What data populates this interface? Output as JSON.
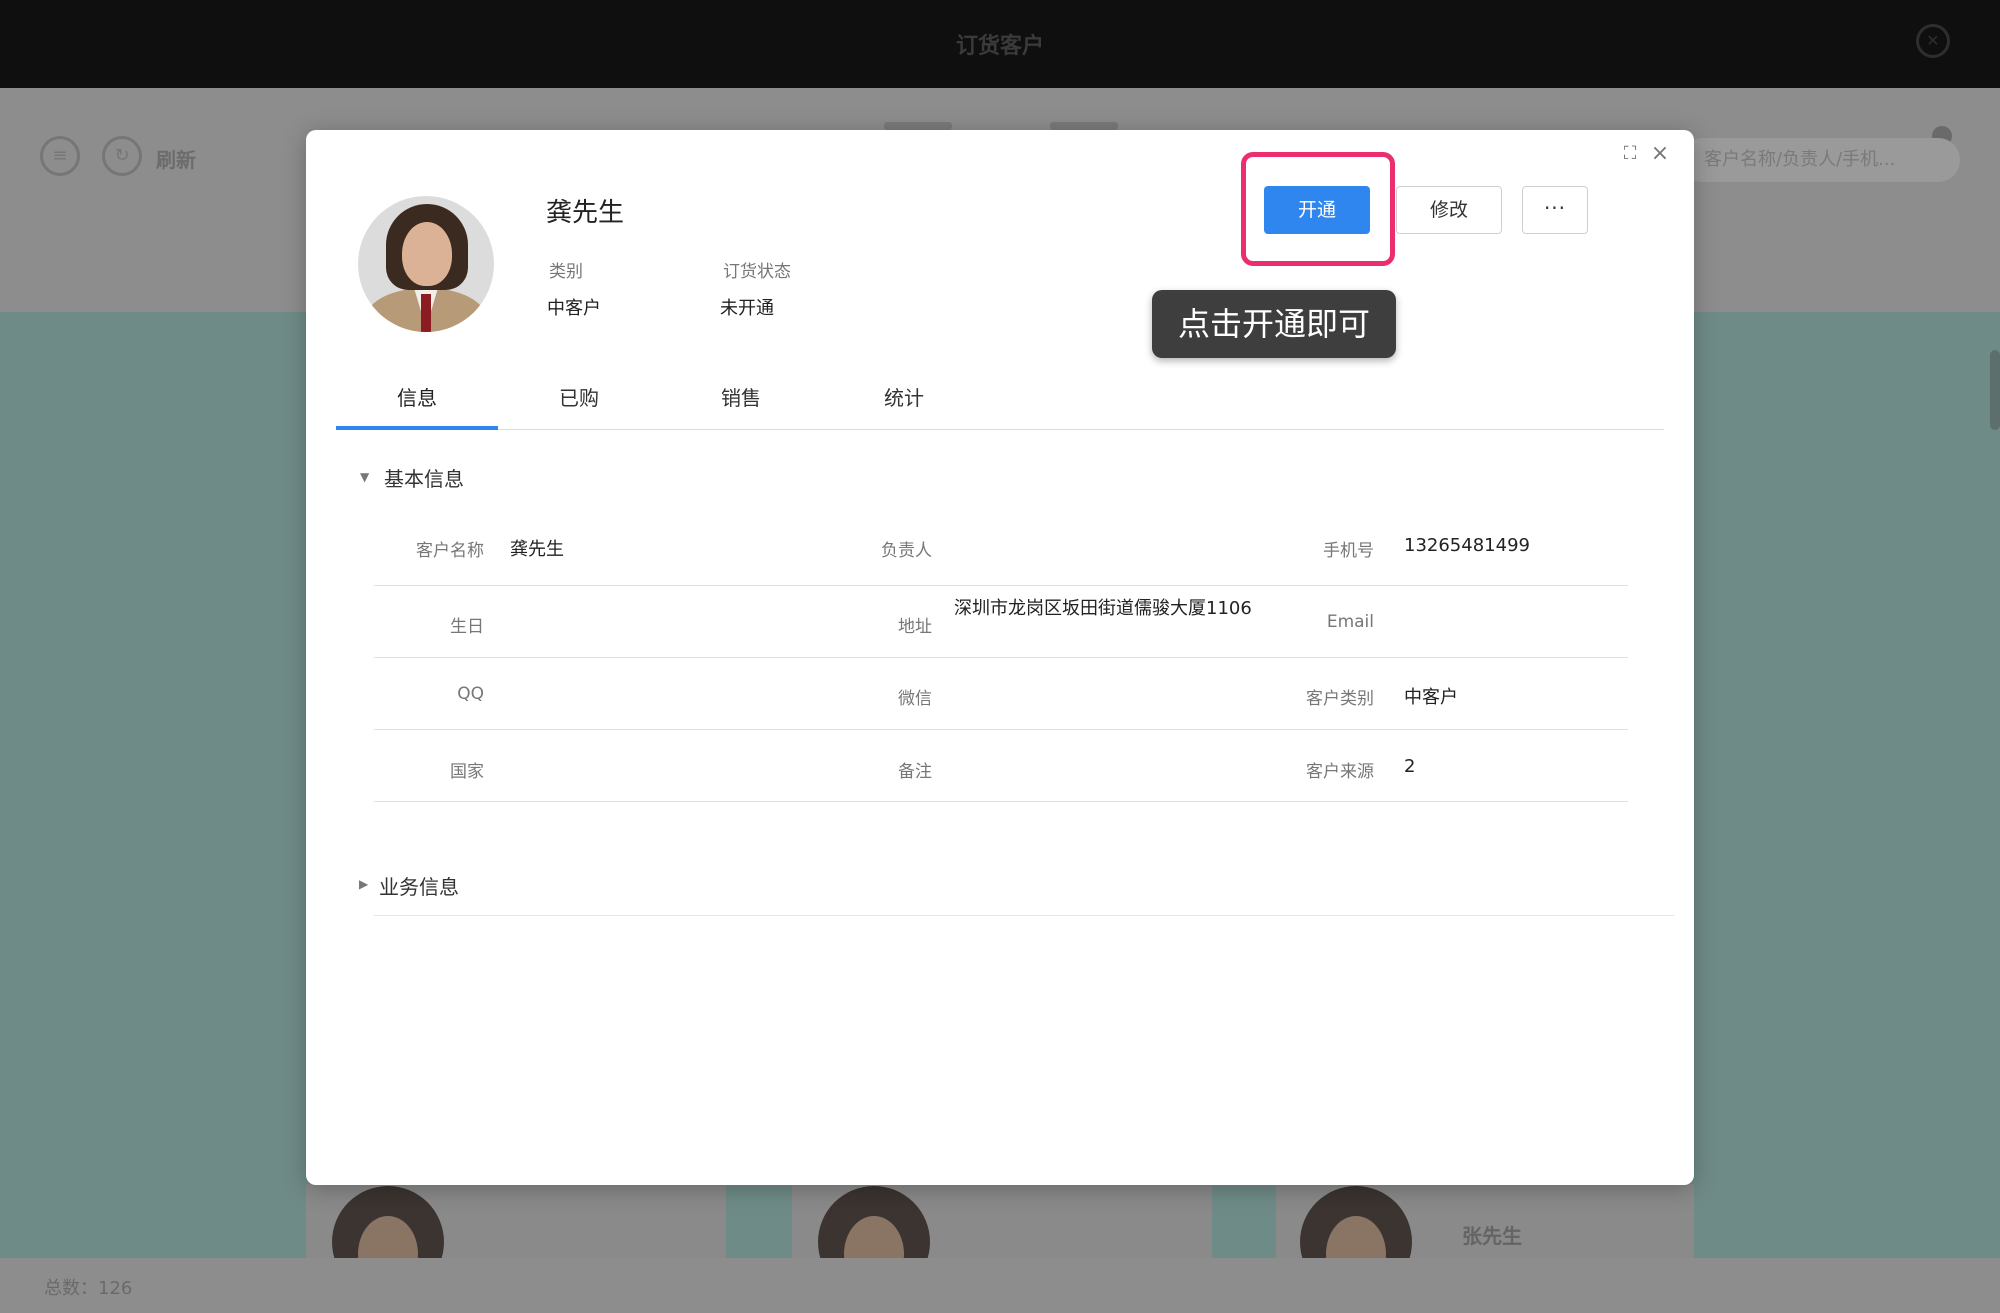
{
  "background": {
    "window_title": "订货客户",
    "refresh_label": "刷新",
    "search_placeholder": "客户名称/负责人/手机...",
    "card_name": "张先生",
    "total_label": "总数：126"
  },
  "modal": {
    "customer_name": "龚先生",
    "meta": [
      {
        "label": "类别",
        "value": "中客户"
      },
      {
        "label": "订货状态",
        "value": "未开通"
      }
    ],
    "buttons": {
      "open": "开通",
      "edit": "修改",
      "more": "···"
    },
    "tooltip": "点击开通即可",
    "tabs": [
      "信息",
      "已购",
      "销售",
      "统计"
    ],
    "active_tab": "信息",
    "basic_section": {
      "title": "基本信息",
      "rows": [
        [
          {
            "label": "客户名称",
            "value": "龚先生"
          },
          {
            "label": "负责人",
            "value": ""
          },
          {
            "label": "手机号",
            "value": "13265481499"
          }
        ],
        [
          {
            "label": "生日",
            "value": ""
          },
          {
            "label": "地址",
            "value": "深圳市龙岗区坂田街道儒骏大厦1106"
          },
          {
            "label": "Email",
            "value": ""
          }
        ],
        [
          {
            "label": "QQ",
            "value": ""
          },
          {
            "label": "微信",
            "value": ""
          },
          {
            "label": "客户类别",
            "value": "中客户"
          }
        ],
        [
          {
            "label": "国家",
            "value": ""
          },
          {
            "label": "备注",
            "value": ""
          },
          {
            "label": "客户来源",
            "value": "2"
          }
        ]
      ]
    },
    "business_section": {
      "title": "业务信息"
    }
  },
  "colors": {
    "accent": "#2f86ee",
    "highlight": "#ea2f6c",
    "tooltip_bg": "#3e3e3e"
  }
}
